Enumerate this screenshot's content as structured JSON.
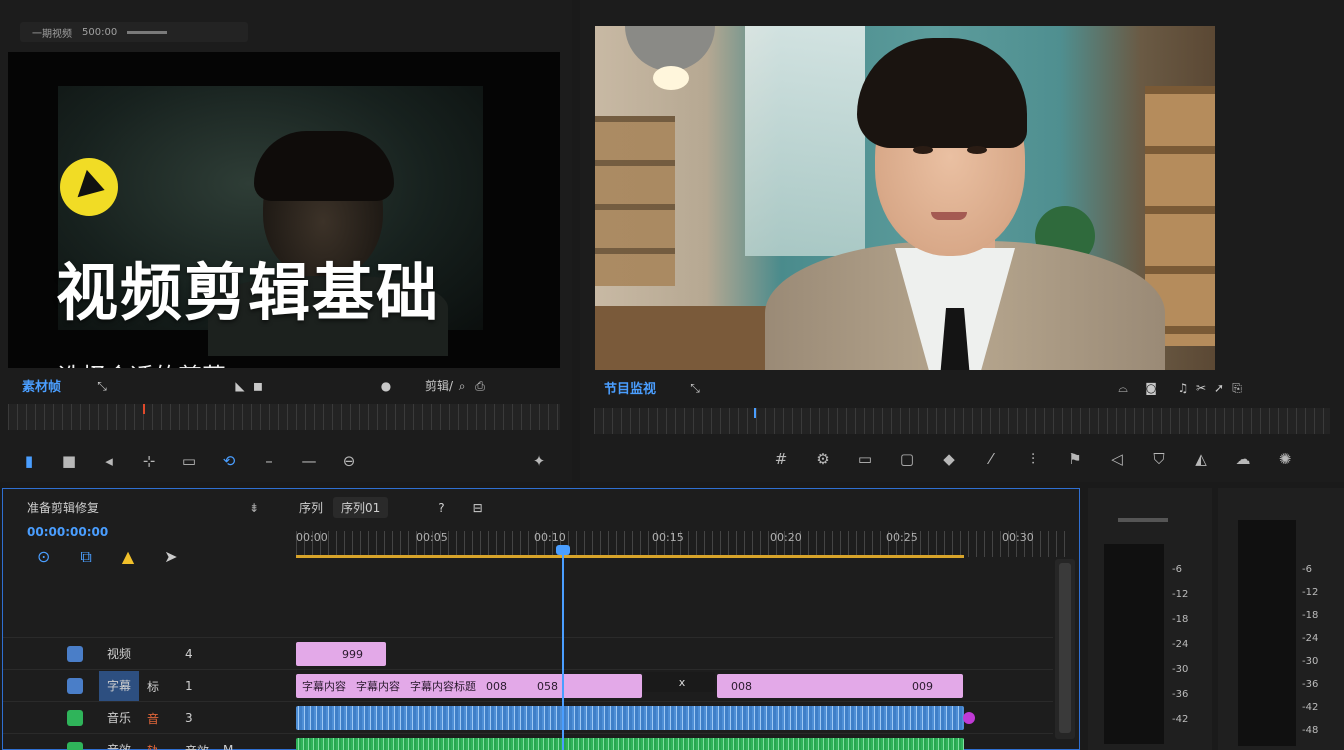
{
  "source_monitor": {
    "tab_labels": [
      "一期视频",
      "500:00"
    ],
    "title_overlay": "视频剪辑基础",
    "subtitle_overlay": "选择合适的剪幕",
    "timecode": "素材帧",
    "ctrl_right": "剪辑/",
    "logo_color": "#f1dc25"
  },
  "program_monitor": {
    "timecode": "节目监视",
    "accent": "#4a9eff"
  },
  "timeline": {
    "panel_title": "准备剪辑修复",
    "timecode": "00:00:00:00",
    "sequence_tab": "序列",
    "sequence_pill": "序列01",
    "ruler_labels": [
      "00:00",
      "00:05",
      "00:10",
      "00:15",
      "00:20",
      "00:25",
      "00:30"
    ],
    "tracks": [
      {
        "name": "视频",
        "a": "",
        "b": "4",
        "c": ""
      },
      {
        "name": "字幕",
        "a": "标",
        "b": "1",
        "c": ""
      },
      {
        "name": "音乐",
        "a": "音",
        "b": "3",
        "c": ""
      },
      {
        "name": "音效",
        "a": "轨",
        "b": "音效",
        "c": "M"
      }
    ],
    "clips": {
      "v_top": "999",
      "subtitle_labels": [
        "字幕内容",
        "字幕内容",
        "字幕内容标题",
        "008",
        "058",
        "x",
        "008",
        "009"
      ]
    },
    "playhead_color": "#4a9eff",
    "workbar_color": "#d8a42a"
  },
  "meter1": {
    "labels": [
      "-6",
      "-12",
      "-18",
      "-24",
      "-30",
      "-36",
      "-42"
    ]
  },
  "meter2": {
    "labels": [
      "-6",
      "-12",
      "-18",
      "-24",
      "-30",
      "-36",
      "-42",
      "-48"
    ]
  }
}
